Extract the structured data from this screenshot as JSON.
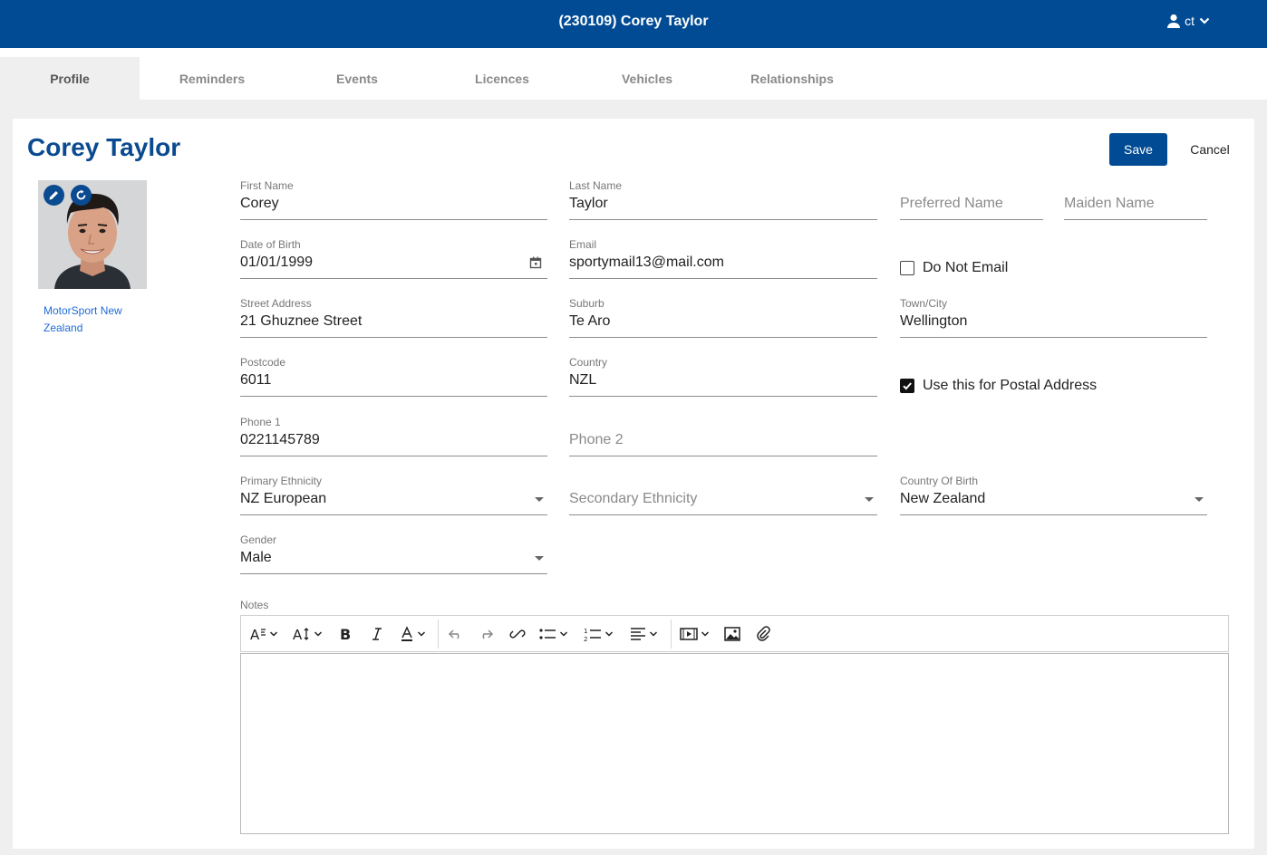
{
  "header": {
    "title": "(230109) Corey Taylor",
    "user_initials": "ct"
  },
  "tabs": [
    {
      "label": "Profile",
      "active": true
    },
    {
      "label": "Reminders",
      "active": false
    },
    {
      "label": "Events",
      "active": false
    },
    {
      "label": "Licences",
      "active": false
    },
    {
      "label": "Vehicles",
      "active": false
    },
    {
      "label": "Relationships",
      "active": false
    }
  ],
  "profile": {
    "name": "Corey Taylor",
    "organisation": "MotorSport New Zealand",
    "save_label": "Save",
    "cancel_label": "Cancel"
  },
  "form": {
    "first_name": {
      "label": "First Name",
      "value": "Corey"
    },
    "last_name": {
      "label": "Last Name",
      "value": "Taylor"
    },
    "preferred_name": {
      "placeholder": "Preferred Name"
    },
    "maiden_name": {
      "placeholder": "Maiden Name"
    },
    "date_of_birth": {
      "label": "Date of Birth",
      "value": "01/01/1999"
    },
    "email": {
      "label": "Email",
      "value": "sportymail13@mail.com"
    },
    "do_not_email": {
      "label": "Do Not Email",
      "checked": false
    },
    "street_address": {
      "label": "Street Address",
      "value": "21 Ghuznee Street"
    },
    "suburb": {
      "label": "Suburb",
      "value": "Te Aro"
    },
    "town_city": {
      "label": "Town/City",
      "value": "Wellington"
    },
    "postcode": {
      "label": "Postcode",
      "value": "6011"
    },
    "country": {
      "label": "Country",
      "value": "NZL"
    },
    "use_for_postal": {
      "label": "Use this for Postal Address",
      "checked": true
    },
    "phone1": {
      "label": "Phone 1",
      "value": "0221145789"
    },
    "phone2": {
      "placeholder": "Phone 2"
    },
    "primary_ethnicity": {
      "label": "Primary Ethnicity",
      "value": "NZ European"
    },
    "secondary_ethnicity": {
      "placeholder": "Secondary Ethnicity"
    },
    "country_of_birth": {
      "label": "Country Of Birth",
      "value": "New Zealand"
    },
    "gender": {
      "label": "Gender",
      "value": "Male"
    },
    "notes": {
      "label": "Notes",
      "value": ""
    }
  },
  "editor_toolbar": [
    "font-family-icon",
    "font-size-icon",
    "bold-icon",
    "italic-icon",
    "font-color-icon",
    "undo-icon",
    "redo-icon",
    "link-icon",
    "bullet-list-icon",
    "numbered-list-icon",
    "align-icon",
    "insert-video-icon",
    "insert-image-icon",
    "attach-file-icon"
  ],
  "colors": {
    "brand": "#004b93",
    "link": "#1e6bd6",
    "page_bg": "#efefef"
  }
}
